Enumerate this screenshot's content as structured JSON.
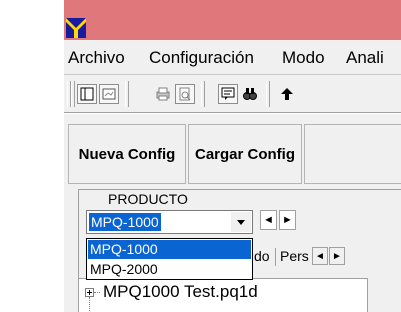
{
  "titlebar": {
    "color": "#e0787b",
    "logo_icon": "app-logo-icon"
  },
  "menu": [
    {
      "label": "Archivo"
    },
    {
      "label": "Configuración"
    },
    {
      "label": "Modo"
    },
    {
      "label": "Anali"
    }
  ],
  "toolbar": {
    "buttons": [
      "view-icon",
      "preview-icon",
      "print-icon",
      "print-preview-icon",
      "comment-icon",
      "find-icon",
      "up-arrow-icon"
    ]
  },
  "buttons": {
    "nueva_config": "Nueva Config",
    "cargar_config": "Cargar Config"
  },
  "producto": {
    "label": "PRODUCTO",
    "selected": "MPQ-1000",
    "options": [
      "MPQ-1000",
      "MPQ-2000"
    ],
    "nav_prev": "◄",
    "nav_next": "►"
  },
  "tabs": {
    "items": [
      "do",
      "Pers"
    ],
    "scroll_left": "◄",
    "scroll_right": "►"
  },
  "tree": {
    "items": [
      {
        "label": "MPQ1000 Test.pq1d"
      }
    ]
  }
}
